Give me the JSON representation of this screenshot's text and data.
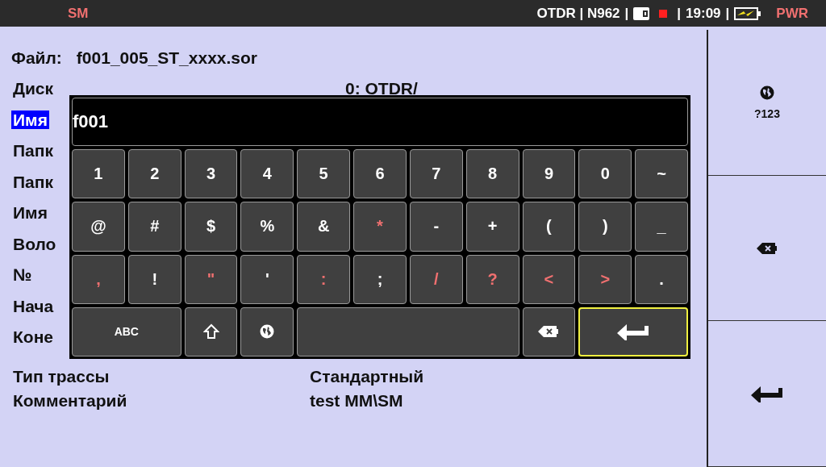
{
  "status_bar": {
    "mode": "SM",
    "instrument": "OTDR | N962",
    "time": "19:09",
    "power": "PWR",
    "separators": [
      "|",
      "|",
      "|"
    ]
  },
  "file": {
    "label": "Файл:",
    "value": "f001_005_ST_xxxx.sor"
  },
  "rows": [
    {
      "label": "Диск",
      "value": "0: OTDR/",
      "selected": false
    },
    {
      "label": "Имя",
      "selected": true
    },
    {
      "label": "Папк",
      "selected": false
    },
    {
      "label": "Папк",
      "selected": false
    },
    {
      "label": "Имя",
      "selected": false
    },
    {
      "label": "Воло",
      "selected": false
    },
    {
      "label": "№",
      "selected": false
    },
    {
      "label": "Нача",
      "selected": false
    },
    {
      "label": "Коне",
      "selected": false
    },
    {
      "label": "Тип трассы",
      "value": "Стандартный",
      "selected": false
    },
    {
      "label": "Комментарий",
      "value": "test MM\\SM",
      "selected": false
    }
  ],
  "keyboard": {
    "input_value": "f001",
    "keys": [
      {
        "kind": "char",
        "label": "1",
        "disabled": false,
        "selected": false
      },
      {
        "kind": "char",
        "label": "2",
        "disabled": false,
        "selected": false
      },
      {
        "kind": "char",
        "label": "3",
        "disabled": false,
        "selected": false
      },
      {
        "kind": "char",
        "label": "4",
        "disabled": false,
        "selected": false
      },
      {
        "kind": "char",
        "label": "5",
        "disabled": false,
        "selected": false
      },
      {
        "kind": "char",
        "label": "6",
        "disabled": false,
        "selected": false
      },
      {
        "kind": "char",
        "label": "7",
        "disabled": false,
        "selected": false
      },
      {
        "kind": "char",
        "label": "8",
        "disabled": false,
        "selected": false
      },
      {
        "kind": "char",
        "label": "9",
        "disabled": false,
        "selected": false
      },
      {
        "kind": "char",
        "label": "0",
        "disabled": false,
        "selected": false
      },
      {
        "kind": "char",
        "label": "~",
        "disabled": false,
        "selected": false
      },
      {
        "kind": "char",
        "label": "@",
        "disabled": false,
        "selected": false
      },
      {
        "kind": "char",
        "label": "#",
        "disabled": false,
        "selected": false
      },
      {
        "kind": "char",
        "label": "$",
        "disabled": false,
        "selected": false
      },
      {
        "kind": "char",
        "label": "%",
        "disabled": false,
        "selected": false
      },
      {
        "kind": "char",
        "label": "&",
        "disabled": false,
        "selected": false
      },
      {
        "kind": "char",
        "label": "*",
        "disabled": true,
        "selected": false
      },
      {
        "kind": "char",
        "label": "-",
        "disabled": false,
        "selected": false
      },
      {
        "kind": "char",
        "label": "+",
        "disabled": false,
        "selected": false
      },
      {
        "kind": "char",
        "label": "(",
        "disabled": false,
        "selected": false
      },
      {
        "kind": "char",
        "label": ")",
        "disabled": false,
        "selected": false
      },
      {
        "kind": "char",
        "label": "_",
        "disabled": false,
        "selected": false
      },
      {
        "kind": "char",
        "label": ",",
        "disabled": true,
        "selected": false
      },
      {
        "kind": "char",
        "label": "!",
        "disabled": false,
        "selected": false
      },
      {
        "kind": "char",
        "label": "\"",
        "disabled": true,
        "selected": false
      },
      {
        "kind": "char",
        "label": "'",
        "disabled": false,
        "selected": false
      },
      {
        "kind": "char",
        "label": ":",
        "disabled": true,
        "selected": false
      },
      {
        "kind": "char",
        "label": ";",
        "disabled": false,
        "selected": false
      },
      {
        "kind": "char",
        "label": "/",
        "disabled": true,
        "selected": false
      },
      {
        "kind": "char",
        "label": "?",
        "disabled": true,
        "selected": false
      },
      {
        "kind": "char",
        "label": "<",
        "disabled": true,
        "selected": false
      },
      {
        "kind": "char",
        "label": ">",
        "disabled": true,
        "selected": false
      },
      {
        "kind": "char",
        "label": ".",
        "disabled": false,
        "selected": false
      },
      {
        "kind": "abc",
        "label": "ABC",
        "disabled": false,
        "selected": false
      },
      {
        "kind": "shift",
        "disabled": false,
        "selected": false
      },
      {
        "kind": "globe",
        "disabled": false,
        "selected": false
      },
      {
        "kind": "space",
        "selected": false
      },
      {
        "kind": "backspace",
        "disabled": false,
        "selected": false
      },
      {
        "kind": "enter",
        "disabled": false,
        "selected": true
      }
    ]
  },
  "side_buttons": [
    {
      "kind": "language",
      "label": "?123"
    },
    {
      "kind": "backspace"
    },
    {
      "kind": "enter"
    }
  ]
}
